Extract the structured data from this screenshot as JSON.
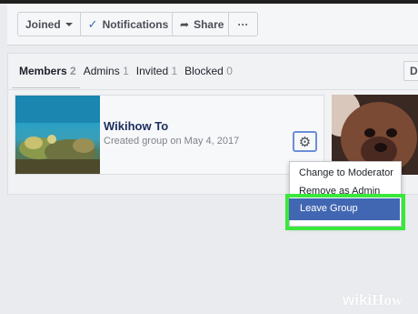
{
  "toolbar": {
    "joined_label": "Joined",
    "notifications_label": "Notifications",
    "share_label": "Share",
    "more_label": "···"
  },
  "tabs": [
    {
      "label": "Members",
      "count": "2"
    },
    {
      "label": "Admins",
      "count": "1"
    },
    {
      "label": "Invited",
      "count": "1"
    },
    {
      "label": "Blocked",
      "count": "0"
    }
  ],
  "right_tab_label": "De",
  "member": {
    "name": "Wikihow To",
    "subtitle": "Created group on May 4, 2017"
  },
  "menu": {
    "items": [
      "Change to Moderator",
      "Remove as Admin"
    ],
    "selected": "Leave Group"
  },
  "watermark": {
    "prefix": "wiki",
    "suffix": "How"
  },
  "colors": {
    "accent": "#4267b2",
    "highlight": "#39e83b"
  },
  "icons": {
    "gear": "gear-icon",
    "share": "share-icon",
    "check": "check-icon",
    "caret": "caret-down-icon"
  }
}
